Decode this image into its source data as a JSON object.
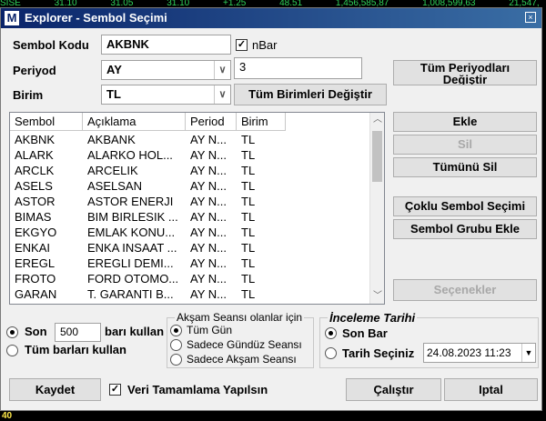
{
  "background": {
    "top_strip": [
      "SISE",
      "31.10",
      "31.05",
      "31.10",
      "+1.25",
      "48.51",
      "1,456,585,87",
      "1,008,599,63",
      "21,547,"
    ],
    "bottom_strip_value": "40"
  },
  "window": {
    "logo": "M",
    "title": "Explorer - Sembol Seçimi",
    "close_glyph": "×"
  },
  "form": {
    "symbol_code_label": "Sembol Kodu",
    "symbol_code_value": "AKBNK",
    "nbar_label": "nBar",
    "nbar_checked": true,
    "period_label": "Periyod",
    "period_value": "AY",
    "nbar_value": "3",
    "unit_label": "Birim",
    "unit_value": "TL",
    "change_all_units_button": "Tüm Birimleri Değiştir",
    "change_all_periods_button_line1": "Tüm Periyodları",
    "change_all_periods_button_line2": "Değiştir"
  },
  "list": {
    "columns": [
      "Sembol",
      "Açıklama",
      "Period",
      "Birim"
    ],
    "rows": [
      [
        "AKBNK",
        "AKBANK",
        "AY N...",
        "TL"
      ],
      [
        "ALARK",
        "ALARKO HOL...",
        "AY N...",
        "TL"
      ],
      [
        "ARCLK",
        "ARCELIK",
        "AY N...",
        "TL"
      ],
      [
        "ASELS",
        "ASELSAN",
        "AY N...",
        "TL"
      ],
      [
        "ASTOR",
        "ASTOR ENERJI",
        "AY N...",
        "TL"
      ],
      [
        "BIMAS",
        "BIM BIRLESIK ...",
        "AY N...",
        "TL"
      ],
      [
        "EKGYO",
        "EMLAK KONU...",
        "AY N...",
        "TL"
      ],
      [
        "ENKAI",
        "ENKA INSAAT ...",
        "AY N...",
        "TL"
      ],
      [
        "EREGL",
        "EREGLI DEMI...",
        "AY N...",
        "TL"
      ],
      [
        "FROTO",
        "FORD OTOMO...",
        "AY N...",
        "TL"
      ],
      [
        "GARAN",
        "T. GARANTI B...",
        "AY N...",
        "TL"
      ]
    ]
  },
  "actions": {
    "add": "Ekle",
    "delete": "Sil",
    "delete_all": "Tümünü Sil",
    "multi_select": "Çoklu Sembol Seçimi",
    "add_group": "Sembol Grubu Ekle",
    "options": "Seçenekler"
  },
  "bars": {
    "last_label": "Son",
    "last_value": "500",
    "last_suffix": "barı kullan",
    "all_label": "Tüm barları kullan"
  },
  "evening_session": {
    "title": "Akşam Seansı olanlar için",
    "options": [
      "Tüm Gün",
      "Sadece Gündüz Seansı",
      "Sadece Akşam Seansı"
    ]
  },
  "review_date": {
    "title": "İnceleme Tarihi",
    "last_bar": "Son Bar",
    "choose_date": "Tarih Seçiniz",
    "date_value": "24.08.2023 11:23"
  },
  "footer": {
    "save": "Kaydet",
    "complete_data_label": "Veri Tamamlama Yapılsın",
    "complete_data_checked": true,
    "run": "Çalıştır",
    "cancel": "Iptal"
  }
}
